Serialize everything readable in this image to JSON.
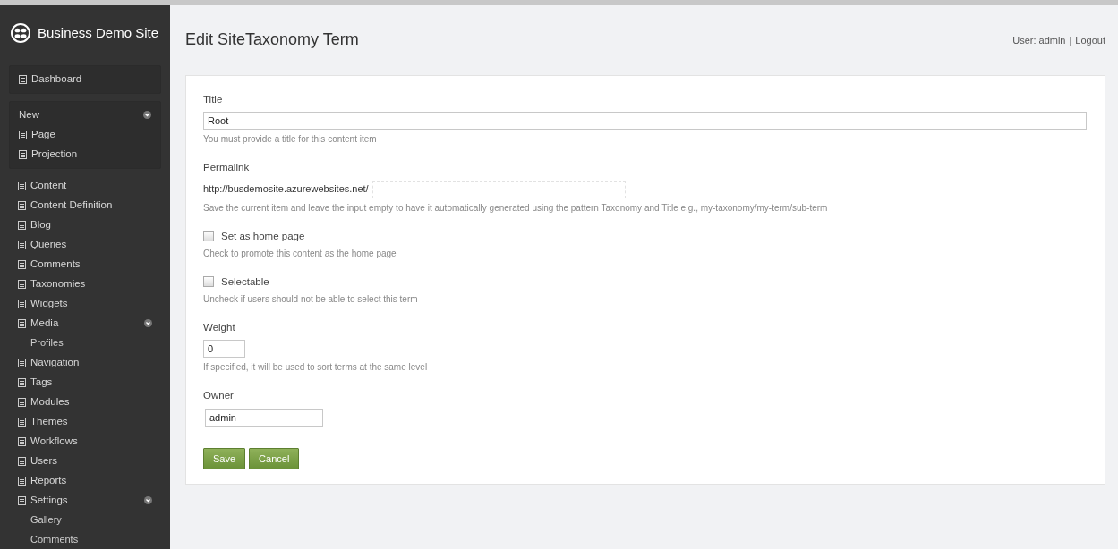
{
  "sidebar": {
    "site_name": "Business Demo Site",
    "menu": [
      {
        "kind": "box",
        "label": "Dashboard"
      },
      {
        "kind": "group",
        "label": "New",
        "expanded": true,
        "children": [
          {
            "label": "Page"
          },
          {
            "label": "Projection"
          }
        ]
      },
      {
        "kind": "item",
        "label": "Content"
      },
      {
        "kind": "item",
        "label": "Content Definition"
      },
      {
        "kind": "item",
        "label": "Blog"
      },
      {
        "kind": "item",
        "label": "Queries"
      },
      {
        "kind": "item",
        "label": "Comments"
      },
      {
        "kind": "item",
        "label": "Taxonomies"
      },
      {
        "kind": "item",
        "label": "Widgets"
      },
      {
        "kind": "item",
        "label": "Media",
        "expanded": true,
        "children": [
          {
            "label": "Profiles"
          }
        ]
      },
      {
        "kind": "item",
        "label": "Navigation"
      },
      {
        "kind": "item",
        "label": "Tags"
      },
      {
        "kind": "item",
        "label": "Modules"
      },
      {
        "kind": "item",
        "label": "Themes"
      },
      {
        "kind": "item",
        "label": "Workflows"
      },
      {
        "kind": "item",
        "label": "Users"
      },
      {
        "kind": "item",
        "label": "Reports"
      },
      {
        "kind": "item",
        "label": "Settings",
        "expanded": true,
        "children": [
          {
            "label": "Gallery"
          },
          {
            "label": "Comments"
          }
        ]
      }
    ]
  },
  "header": {
    "title": "Edit SiteTaxonomy Term",
    "user_label": "User: admin",
    "separator": "|",
    "logout": "Logout"
  },
  "form": {
    "fields": [
      {
        "kind": "text",
        "label": "Title",
        "value": "Root",
        "hint": "You must provide a title for this content item"
      },
      {
        "kind": "permalink",
        "label": "Permalink",
        "prefix": "http://busdemosite.azurewebsites.net/",
        "hint": "Save the current item and leave the input empty to have it automatically generated using the pattern Taxonomy and Title e.g., my-taxonomy/my-term/sub-term"
      },
      {
        "kind": "checkbox",
        "label": "Set as home page",
        "checked": false,
        "hint": "Check to promote this content as the home page"
      },
      {
        "kind": "checkbox",
        "label": "Selectable",
        "checked": false,
        "hint": "Uncheck if users should not be able to select this term"
      },
      {
        "kind": "number",
        "label": "Weight",
        "value": "0",
        "hint": "If specified, it will be used to sort terms at the same level"
      },
      {
        "kind": "user",
        "label": "Owner",
        "value": "admin"
      }
    ],
    "buttons": [
      "Save",
      "Cancel"
    ]
  }
}
